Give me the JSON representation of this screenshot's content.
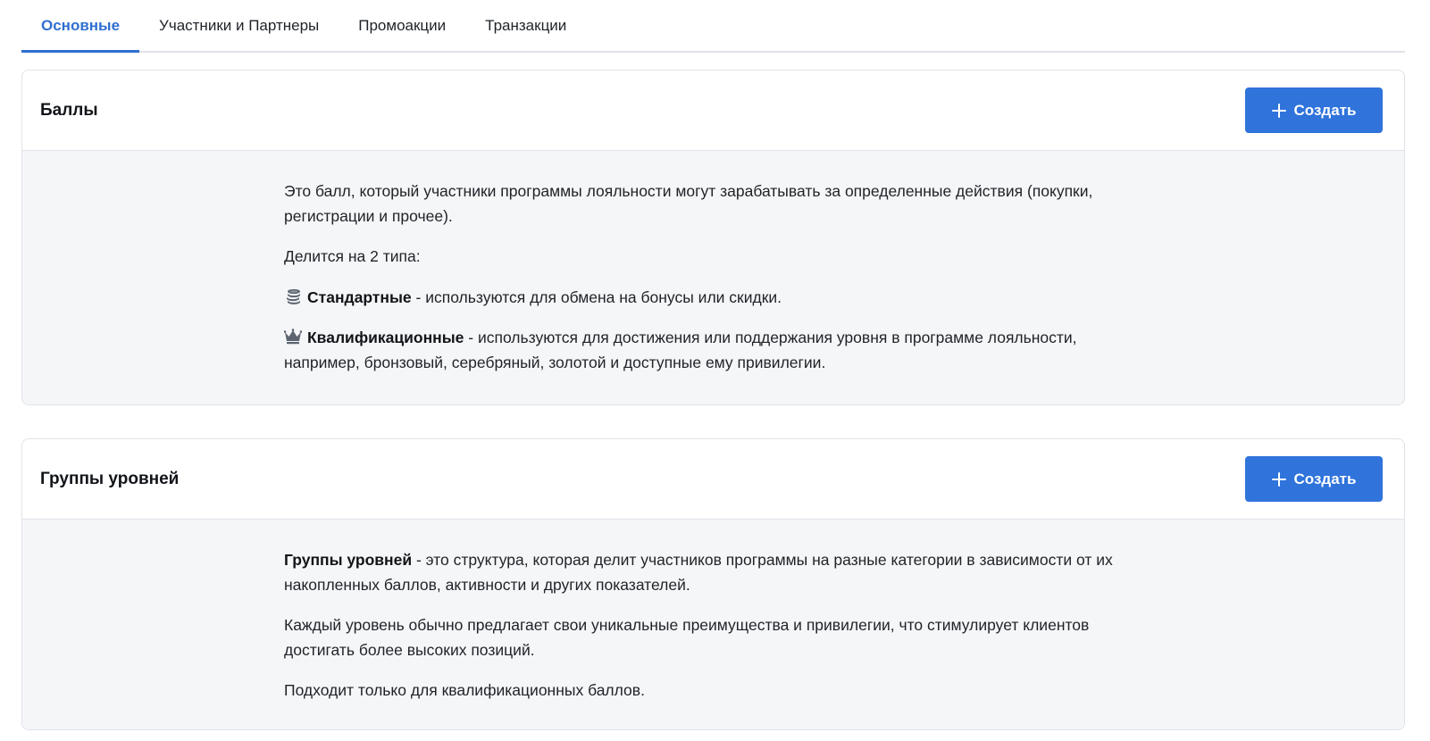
{
  "tabs": [
    {
      "label": "Основные",
      "active": true
    },
    {
      "label": "Участники и Партнеры",
      "active": false
    },
    {
      "label": "Промоакции",
      "active": false
    },
    {
      "label": "Транзакции",
      "active": false
    }
  ],
  "points": {
    "title": "Баллы",
    "create_label": "Создать",
    "description": "Это балл, который участники программы лояльности могут зарабатывать за определенные действия (покупки, регистрации и прочее).",
    "types_intro": "Делится на 2 типа:",
    "standard": {
      "icon": "coins-icon",
      "name": "Стандартные",
      "text": " - используются для обмена на бонусы или скидки."
    },
    "qualifying": {
      "icon": "crown-icon",
      "name": "Квалификационные",
      "text": " - используются для достижения или поддержания уровня в программе лояльности, например, бронзовый, серебряный, золотой и доступные ему привилегии."
    }
  },
  "tiers": {
    "title": "Группы уровней",
    "create_label": "Создать",
    "definition_term": "Группы уровней",
    "definition_text": " - это структура, которая делит участников программы на разные категории в зависимости от их накопленных баллов, активности и других показателей.",
    "benefits": "Каждый уровень обычно предлагает свои уникальные преимущества и привилегии, что стимулирует клиентов достигать более высоких позиций.",
    "note": "Подходит только для квалификационных баллов."
  },
  "colors": {
    "accent": "#2f73db",
    "active_tab": "#2f6fd0",
    "card_body_bg": "#f5f6f8",
    "border": "#dfe3e8"
  }
}
